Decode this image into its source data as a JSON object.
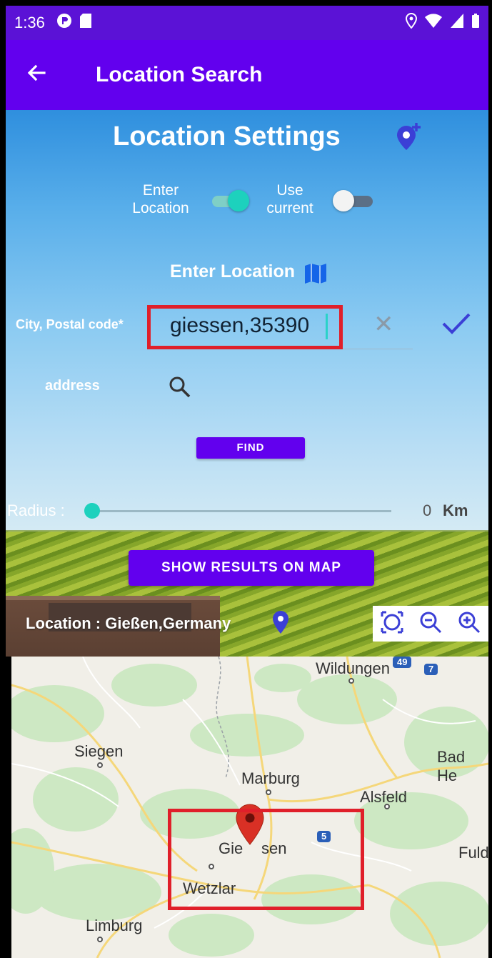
{
  "status_bar": {
    "time": "1:36"
  },
  "app_bar": {
    "title": "Location Search"
  },
  "settings": {
    "heading": "Location Settings",
    "toggle_enter_label": "Enter\nLocation",
    "toggle_current_label": "Use\ncurrent",
    "toggle_enter_on": true,
    "toggle_current_on": false,
    "subheading": "Enter Location",
    "city_label": "City, Postal code*",
    "city_value": "giessen,35390",
    "address_label": "address",
    "find_label": "FIND",
    "radius_label": "Radius :",
    "radius_value": "0",
    "radius_unit": "Km",
    "radius_fraction": 0,
    "show_map_label": "SHOW RESULTS ON MAP",
    "location_text": "Location : Gießen,Germany"
  },
  "map": {
    "cities": [
      "Wildungen",
      "Siegen",
      "Marburg",
      "Alsfeld",
      "Bad He",
      "Gie",
      "sen",
      "Fuld",
      "Wetzlar",
      "Limburg"
    ],
    "shields": [
      "49",
      "7",
      "5"
    ]
  },
  "colors": {
    "primary": "#6200ee",
    "accent": "#1dd1bd",
    "highlight": "#e01f2a",
    "pin": "#d93025"
  },
  "icons": [
    "back-arrow-icon",
    "add-location-icon",
    "map-icon",
    "clear-icon",
    "check-icon",
    "search-icon",
    "location-pin-icon",
    "recenter-icon",
    "zoom-out-icon",
    "zoom-in-icon"
  ]
}
